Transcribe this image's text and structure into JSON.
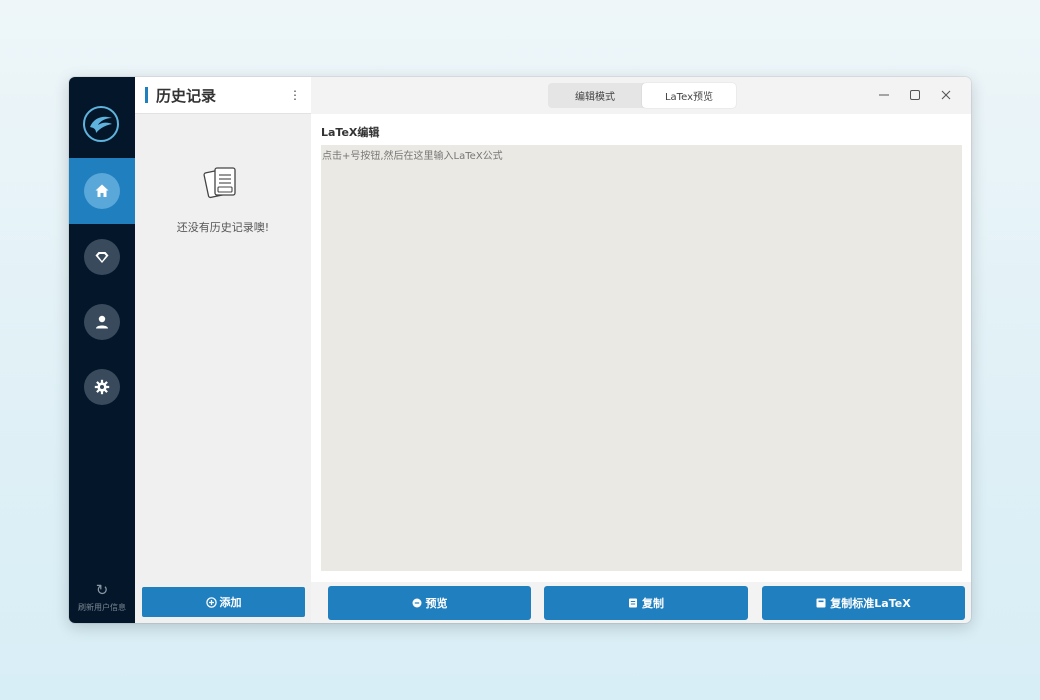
{
  "nav": {
    "items": [
      {
        "name": "home",
        "icon": "home-icon",
        "active": true
      },
      {
        "name": "gem",
        "icon": "gem-icon",
        "active": false
      },
      {
        "name": "user",
        "icon": "user-icon",
        "active": false
      },
      {
        "name": "settings",
        "icon": "gear-icon",
        "active": false
      }
    ],
    "refresh_label": "刷新用户信息"
  },
  "history": {
    "title": "历史记录",
    "empty_text": "还没有历史记录噢!",
    "add_label": "添加"
  },
  "tabs": [
    {
      "label": "编辑模式",
      "selected": false
    },
    {
      "label": "LaTex预览",
      "selected": true
    }
  ],
  "editor": {
    "label": "LaTeX编辑",
    "placeholder": "点击+号按钮,然后在这里输入LaTeX公式",
    "value": ""
  },
  "actions": {
    "preview": "预览",
    "copy": "复制",
    "copy_standard": "复制标准LaTeX"
  },
  "colors": {
    "accent": "#1f7fbf",
    "nav_bg": "#04172a",
    "editor_bg": "#ebe9e3"
  }
}
